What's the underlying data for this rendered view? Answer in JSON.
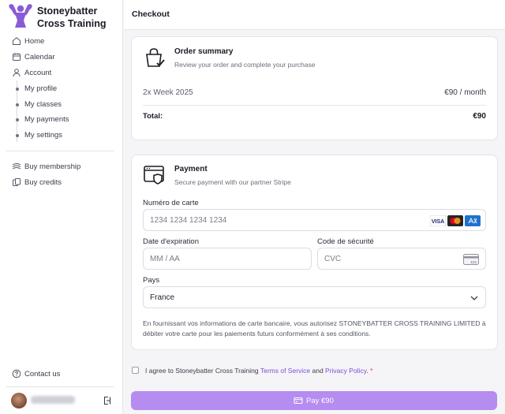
{
  "brand": {
    "name": "Stoneybatter Cross Training",
    "logo_icon": "flexing-athlete-logo",
    "logo_color": "#8a5bd6"
  },
  "sidebar": {
    "items": [
      {
        "label": "Home",
        "icon": "home-icon"
      },
      {
        "label": "Calendar",
        "icon": "calendar-icon"
      },
      {
        "label": "Account",
        "icon": "user-icon"
      }
    ],
    "account_items": [
      {
        "label": "My profile"
      },
      {
        "label": "My classes"
      },
      {
        "label": "My payments"
      },
      {
        "label": "My settings"
      }
    ],
    "shop_items": [
      {
        "label": "Buy membership",
        "icon": "ticket-icon"
      },
      {
        "label": "Buy credits",
        "icon": "coins-icon"
      }
    ],
    "contact": {
      "label": "Contact us",
      "icon": "help-icon"
    }
  },
  "header": {
    "title": "Checkout"
  },
  "order": {
    "title": "Order summary",
    "subtitle": "Review your order and complete your purchase",
    "item_name": "2x Week 2025",
    "item_price": "€90 / month",
    "total_label": "Total:",
    "total_value": "€90"
  },
  "payment": {
    "title": "Payment",
    "subtitle": "Secure payment with our partner Stripe",
    "card_label": "Numéro de carte",
    "card_placeholder": "1234 1234 1234 1234",
    "card_brands": [
      "VISA",
      "mastercard",
      "amex"
    ],
    "expiry_label": "Date d'expiration",
    "expiry_placeholder": "MM / AA",
    "cvc_label": "Code de sécurité",
    "cvc_placeholder": "CVC",
    "cvc_badge": "123",
    "country_label": "Pays",
    "country_value": "France",
    "mandate": "En fournissant vos informations de carte bancaire, vous autorisez STONEYBATTER CROSS TRAINING LIMITED à débiter votre carte pour les paiements futurs conformément à ses conditions."
  },
  "agree": {
    "prefix": "I agree to Stoneybatter Cross Training ",
    "terms": "Terms of Service",
    "and": " and ",
    "privacy": "Privacy Policy",
    "suffix": ".",
    "required": " *"
  },
  "pay_button": {
    "label": "Pay €90",
    "color": "#b58cf0"
  },
  "colors": {
    "accent": "#7c4ddb",
    "background": "#f5f5f7"
  }
}
